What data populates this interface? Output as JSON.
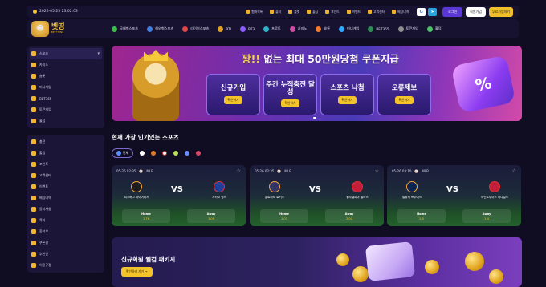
{
  "topbar": {
    "datetime": "2026-05-25 23:02:03",
    "links": [
      "햄퍼목록",
      "출석",
      "룰렛",
      "출금",
      "포인트",
      "이벤트",
      "고객센터",
      "베팅내역"
    ],
    "social": {
      "google": "G",
      "telegram": "➤"
    },
    "login_label": "로그인",
    "join_label": "회원가입",
    "free_label": "무료가입하기"
  },
  "logo": {
    "title": "벳띵",
    "sub": "BETTHING"
  },
  "nav": {
    "items": [
      "국내형스포츠",
      "해외형스포츠",
      "라이브스포츠",
      "BTI",
      "BT3",
      "프로토",
      "카지노",
      "슬롯",
      "미니게임",
      "BET365",
      "토큰게임",
      "홀덤"
    ],
    "colors": [
      "#3dbb4a",
      "#3f7fe0",
      "#e04848",
      "#e0a020",
      "#8a5cff",
      "#2fb3c9",
      "#d04ca0",
      "#f07a2a",
      "#30a8ff",
      "#2e8b57",
      "#8e8e8e",
      "#4cbf6a"
    ]
  },
  "sidebar": {
    "group1": [
      "스포츠",
      "카지노",
      "슬롯",
      "미니게임",
      "BET365",
      "토큰게임",
      "홀덤"
    ],
    "group2": [
      "충전",
      "출금",
      "포인트",
      "고객센터",
      "이벤트",
      "베팅내역",
      "공지사항",
      "쪽지",
      "출석부",
      "쿠폰함",
      "추천인",
      "이용규정"
    ]
  },
  "banner": {
    "headline_a": "꽝!!",
    "headline_b": " 없는 최대 50만원당첨 쿠폰지급",
    "cards": [
      {
        "title": "신규가입",
        "button": "확인하기"
      },
      {
        "title": "주간 누적충전 달성",
        "button": "확인하기"
      },
      {
        "title": "스포츠 낙첨",
        "button": "확인하기"
      },
      {
        "title": "오류제보",
        "button": "확인하기"
      }
    ],
    "pct_symbol": "%"
  },
  "section": {
    "title": "현재 가장 인기있는 스포츠",
    "filter_all": "전체"
  },
  "matches": [
    {
      "time": "05-26 02:35",
      "league": "MLB",
      "home": "피츠버그 파이어리츠",
      "away": "시카고 컵스",
      "home_odds": "1.76",
      "away_odds": "1.09",
      "home_color": "#1d1d1d",
      "away_color": "#1f3f9a"
    },
    {
      "time": "05-26 02:35",
      "league": "MLB",
      "home": "콜로라도 로키스",
      "away": "필라델피아 필리스",
      "home_odds": "1.03",
      "away_odds": "2.00",
      "home_color": "#333366",
      "away_color": "#c41e3a"
    },
    {
      "time": "05-26 03:10",
      "league": "MLB",
      "home": "밀워키 브루어스",
      "away": "세인트루이스 카디널스",
      "home_odds": "2.5",
      "away_odds": "1.4",
      "home_color": "#0a2351",
      "away_color": "#c41e3a"
    }
  ],
  "odds_labels": {
    "home": "Home",
    "away": "Away",
    "vs": "VS"
  },
  "promo": {
    "title": "신규회원 웰컴 패키지",
    "button": "확인하러 가기 →"
  }
}
